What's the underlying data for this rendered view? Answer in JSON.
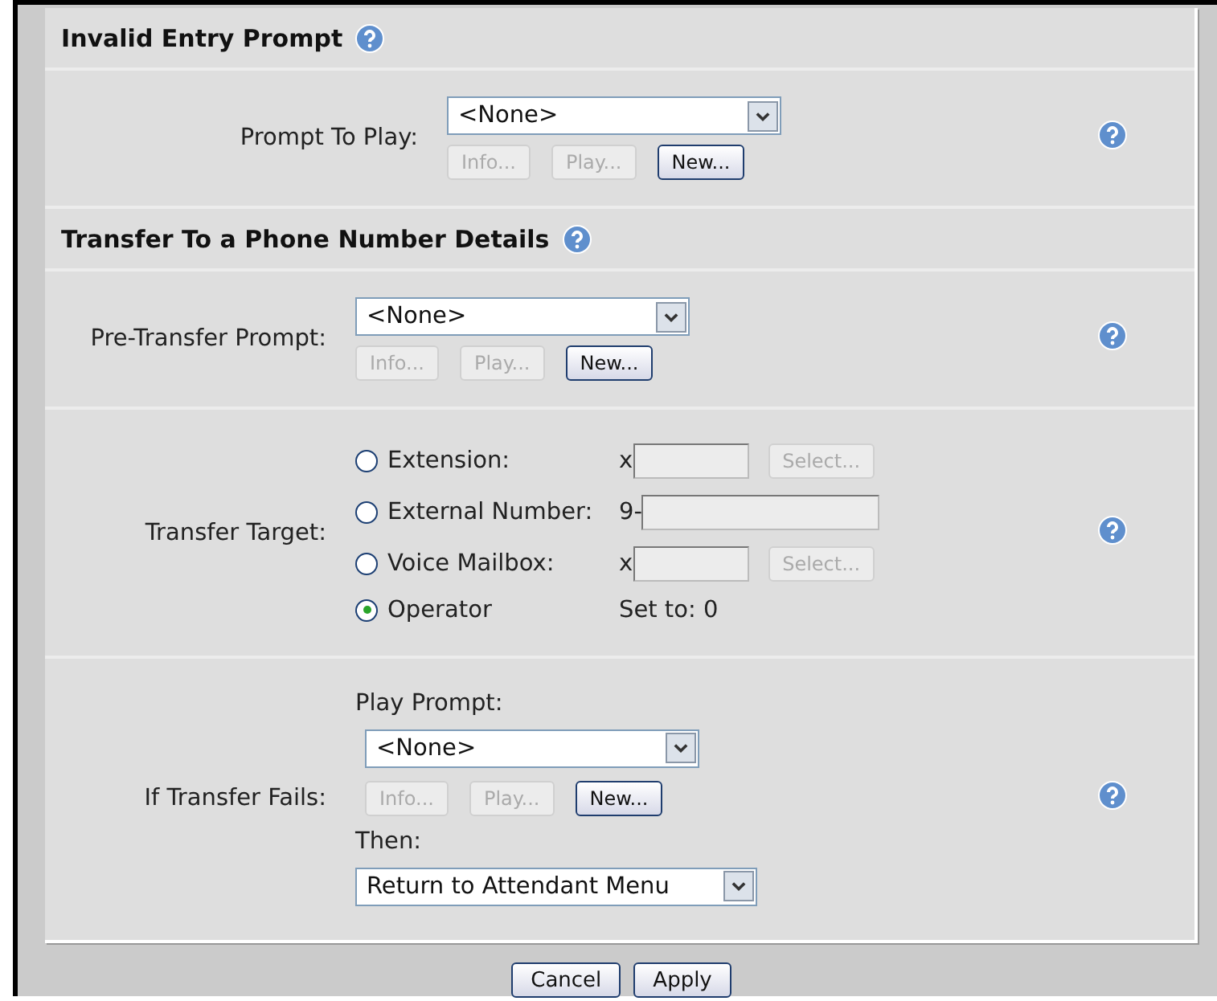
{
  "sections": [
    {
      "title": "Invalid Entry Prompt",
      "help": true,
      "rows": [
        {
          "kind": "prompt",
          "label": "Prompt To Play:",
          "help": true,
          "select": {
            "value": "<None>"
          },
          "buttons": [
            {
              "label": "Info...",
              "disabled": true
            },
            {
              "label": "Play...",
              "disabled": true
            },
            {
              "label": "New...",
              "disabled": false
            }
          ]
        }
      ]
    },
    {
      "title": "Transfer To a Phone Number Details",
      "help": true,
      "rows": [
        {
          "kind": "prompt",
          "label": "Pre-Transfer Prompt:",
          "help": true,
          "select": {
            "value": "<None>"
          },
          "buttons": [
            {
              "label": "Info...",
              "disabled": true
            },
            {
              "label": "Play...",
              "disabled": true
            },
            {
              "label": "New...",
              "disabled": false
            }
          ]
        },
        {
          "kind": "target",
          "label": "Transfer Target:",
          "help": true,
          "options": [
            {
              "label": "Extension:",
              "selected": false,
              "prefix": "x",
              "field": {
                "kind": "short"
              },
              "button": {
                "label": "Select...",
                "disabled": true
              }
            },
            {
              "label": "External Number:",
              "selected": false,
              "prefix": "9-",
              "field": {
                "kind": "long"
              }
            },
            {
              "label": "Voice Mailbox:",
              "selected": false,
              "prefix": "x",
              "field": {
                "kind": "short"
              },
              "button": {
                "label": "Select...",
                "disabled": true
              }
            },
            {
              "label": "Operator",
              "selected": true,
              "note": "Set to: 0"
            }
          ]
        },
        {
          "kind": "fails",
          "label": "If Transfer Fails:",
          "help": true,
          "prompt_label": "Play Prompt:",
          "select": {
            "value": "<None>"
          },
          "buttons": [
            {
              "label": "Info...",
              "disabled": true
            },
            {
              "label": "Play...",
              "disabled": true
            },
            {
              "label": "New...",
              "disabled": false
            }
          ],
          "then_label": "Then:",
          "then_select": {
            "value": "Return to Attendant Menu"
          }
        }
      ]
    }
  ],
  "footer": [
    {
      "label": "Cancel"
    },
    {
      "label": "Apply"
    }
  ]
}
